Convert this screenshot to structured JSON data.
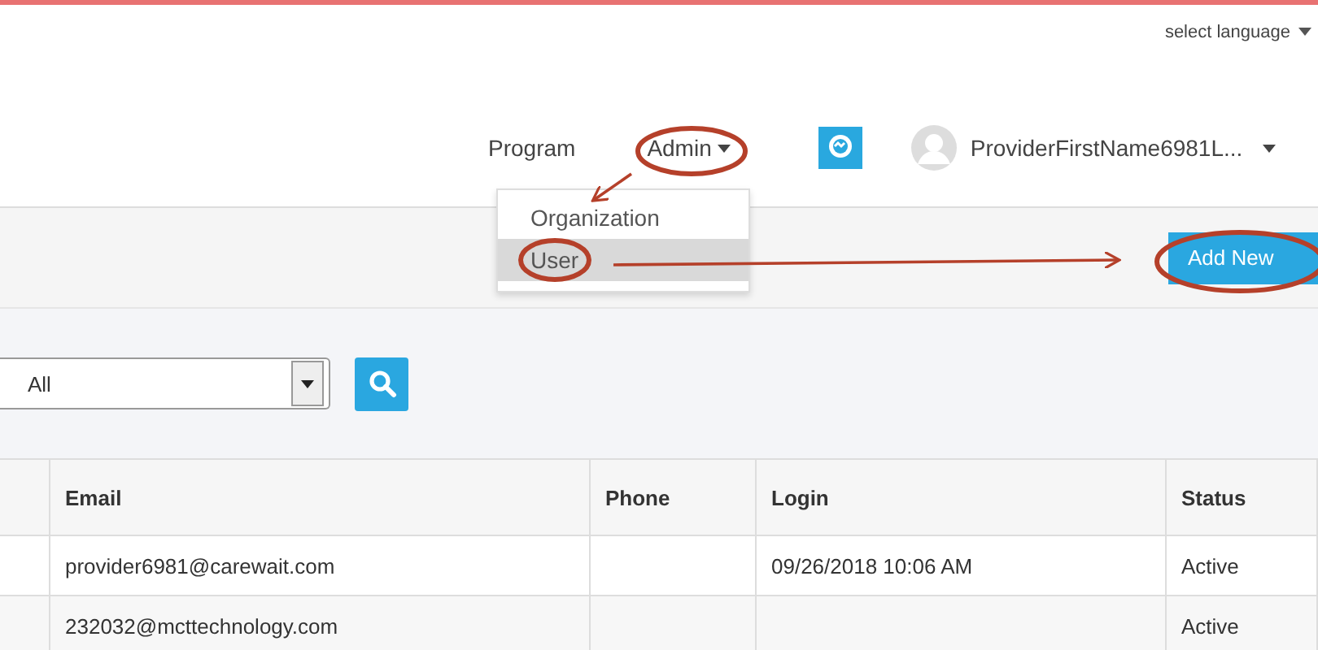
{
  "language": {
    "label": "select language"
  },
  "nav": {
    "items": [
      {
        "label": "Program",
        "open": false
      },
      {
        "label": "Admin",
        "open": true
      }
    ],
    "user_name": "ProviderFirstName6981L..."
  },
  "admin_menu": [
    {
      "label": "Organization",
      "selected": false
    },
    {
      "label": "User",
      "selected": true
    }
  ],
  "add_button": "Add New",
  "filter": {
    "value": "All"
  },
  "table": {
    "columns": [
      "Email",
      "Phone",
      "Login",
      "Status"
    ],
    "rows": [
      {
        "email": "provider6981@carewait.com",
        "login": "09/26/2018 10:06 AM",
        "status": "Active"
      },
      {
        "email": "232032@mcttechnology.com",
        "status": "Active"
      }
    ]
  }
}
